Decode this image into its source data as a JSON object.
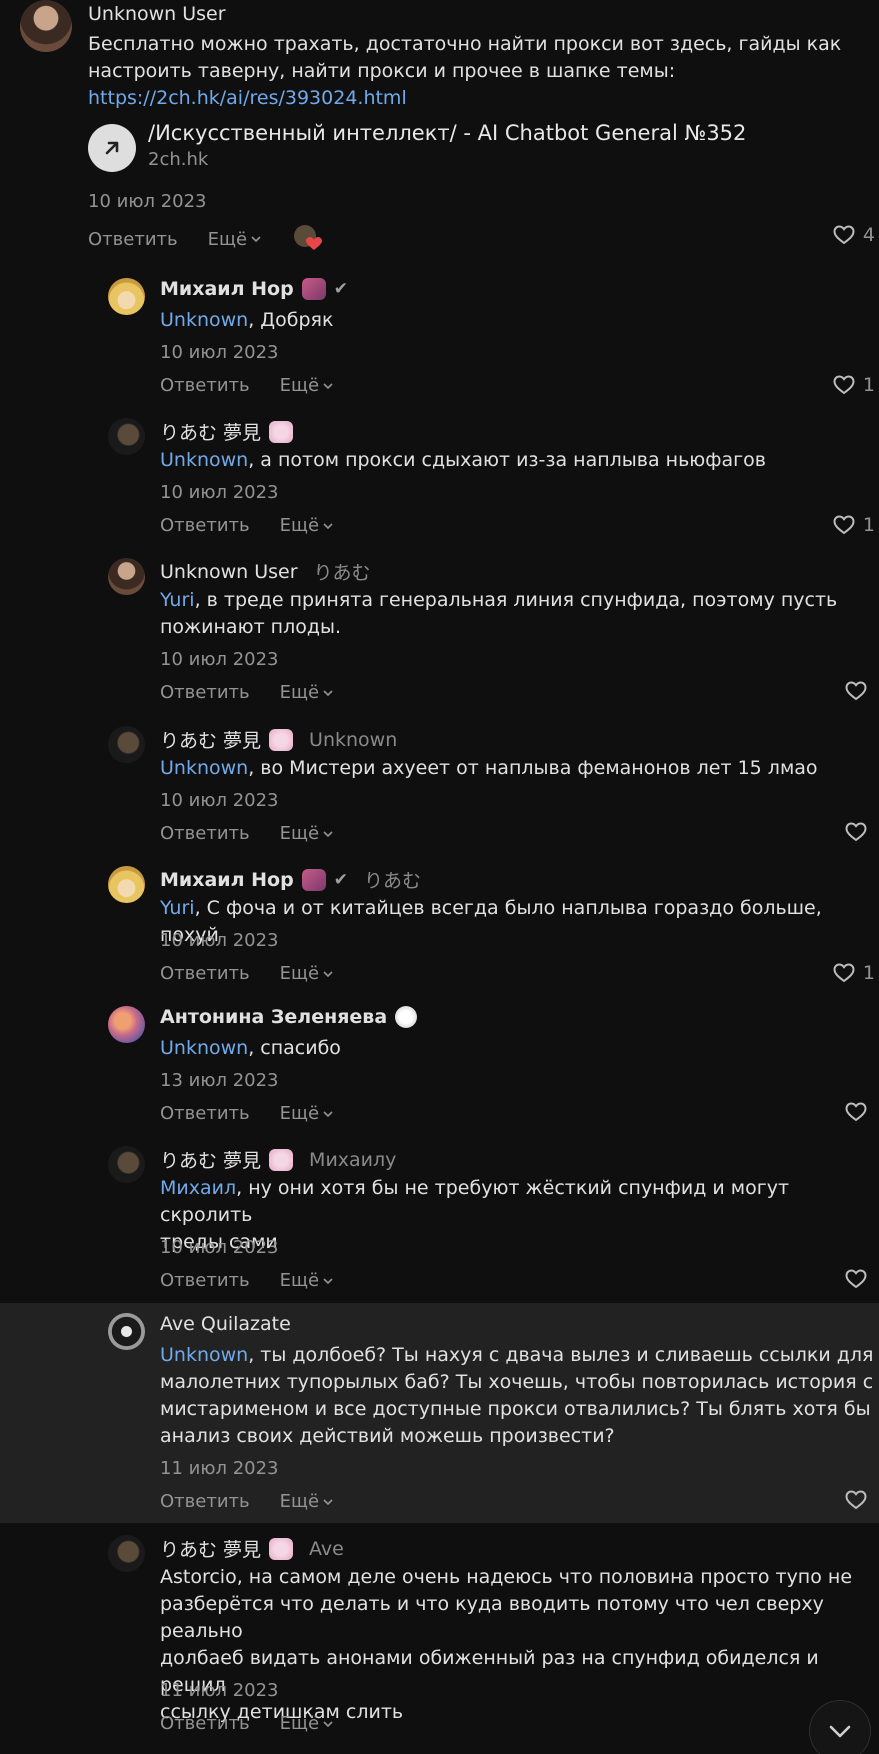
{
  "ui": {
    "reply_label": "Ответить",
    "more_label": "Ещё"
  },
  "root": {
    "author": "Unknown User",
    "text_line1": "Бесплатно можно трахать, достаточно найти прокси вот здесь, гайды как",
    "text_line2": "настроить таверну, найти прокси и прочее в шапке темы:",
    "link": "https://2ch.hk/ai/res/393024.html",
    "card_title": "/Искусственный интеллект/ - AI Chatbot General №352",
    "card_domain": "2ch.hk",
    "date": "10 июл 2023",
    "likes": "4"
  },
  "comments": [
    {
      "author": "Михаил Нор",
      "reply_to": "",
      "mention": "Unknown",
      "text": ", Добряк",
      "date": "10 июл 2023",
      "likes": "1"
    },
    {
      "author": "りあむ 夢見",
      "reply_to": "",
      "mention": "Unknown",
      "text": ", а потом прокси сдыхают из-за наплыва ньюфагов",
      "date": "10 июл 2023",
      "likes": "1"
    },
    {
      "author": "Unknown User",
      "reply_to": "りあむ",
      "mention": "Yuri",
      "text_line1": ", в треде принята генеральная линия спунфида, поэтому пусть",
      "text_line2": "пожинают плоды.",
      "date": "10 июл 2023",
      "likes": ""
    },
    {
      "author": "りあむ 夢見",
      "reply_to": "Unknown",
      "mention": "Unknown",
      "text": ", во Мистери ахуеет от наплыва феманонов лет 15 лмао",
      "date": "10 июл 2023",
      "likes": ""
    },
    {
      "author": "Михаил Нор",
      "reply_to": "りあむ",
      "mention": "Yuri",
      "text": ", С фоча и от китайцев всегда было наплыва гораздо больше, похуй",
      "date": "10 июл 2023",
      "likes": "1"
    },
    {
      "author": "Антонина Зеленяева",
      "reply_to": "",
      "mention": "Unknown",
      "text": ", спасибо",
      "date": "13 июл 2023",
      "likes": ""
    },
    {
      "author": "りあむ 夢見",
      "reply_to": "Михаилу",
      "mention": "Михаил",
      "text_line1": ", ну они хотя бы не требуют жёсткий спунфид и могут скролить",
      "text_line2": "треды сами",
      "date": "10 июл 2023",
      "likes": ""
    },
    {
      "author": "Ave Quilazate",
      "reply_to": "",
      "mention": "Unknown",
      "text_line1": ", ты долбоеб? Ты нахуя с двача вылез и сливаешь ссылки для",
      "text_line2": "малолетних тупорылых баб? Ты хочешь, чтобы повторилась история с",
      "text_line3": "мистарименом и все доступные прокси отвалились? Ты блять хотя бы",
      "text_line4": "анализ своих действий можешь произвести?",
      "date": "11 июл 2023",
      "likes": ""
    },
    {
      "author": "りあむ 夢見",
      "reply_to": "Ave",
      "text_line1": "Astorcio, на самом деле очень надеюсь что половина просто тупо не",
      "text_line2": "разберётся что делать и что куда вводить потому что чел сверху реально",
      "text_line3": "долбаеб видать анонами обиженный раз на спунфид обиделся и решил",
      "text_line4": "ссылку детишкам слить",
      "date": "11 июл 2023",
      "likes": ""
    }
  ],
  "colors": {
    "background": "#0f0f0f",
    "highlight": "#222222",
    "mention": "#71aaeb",
    "secondary": "#939393",
    "text": "#e1e1e1"
  },
  "icons": [
    "external-link-icon",
    "heart-icon",
    "chevron-down-icon",
    "checkmark-icon",
    "emoji-sticker-icon",
    "reaction-icon"
  ]
}
